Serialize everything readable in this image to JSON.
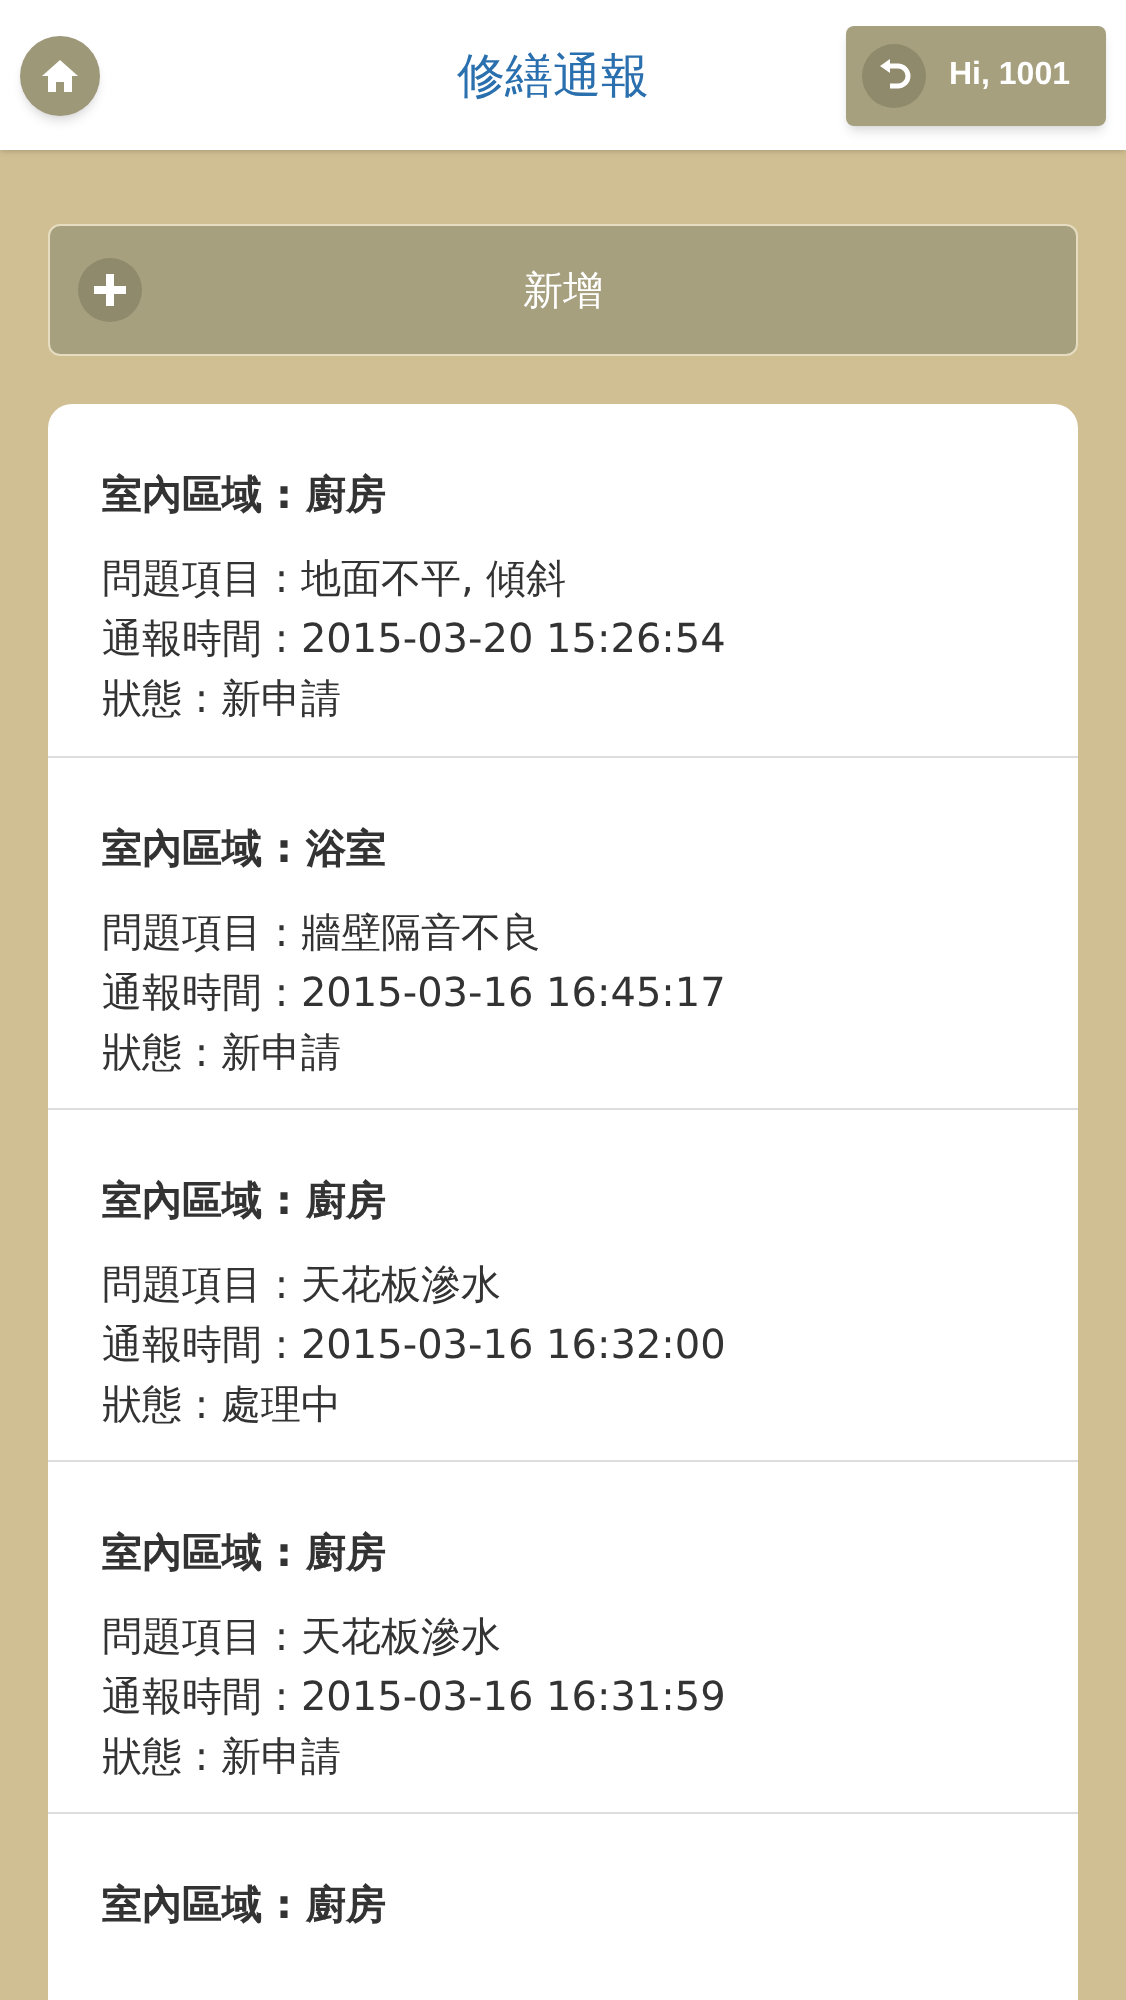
{
  "header": {
    "title": "修繕通報",
    "user_button": "Hi, 1001"
  },
  "add_button": {
    "label": "新增"
  },
  "reports": [
    {
      "area": "室內區域 : 廚房",
      "issue": "問題項目 : 地面不平, 傾斜",
      "time": "通報時間 : 2015-03-20 15:26:54",
      "status": "狀態 : 新申請"
    },
    {
      "area": "室內區域 : 浴室",
      "issue": "問題項目 : 牆壁隔音不良",
      "time": "通報時間 : 2015-03-16 16:45:17",
      "status": "狀態 : 新申請"
    },
    {
      "area": "室內區域 : 廚房",
      "issue": "問題項目 : 天花板滲水",
      "time": "通報時間 : 2015-03-16 16:32:00",
      "status": "狀態 : 處理中"
    },
    {
      "area": "室內區域 : 廚房",
      "issue": "問題項目 : 天花板滲水",
      "time": "通報時間 : 2015-03-16 16:31:59",
      "status": "狀態 : 新申請"
    },
    {
      "area": "室內區域 : 廚房"
    }
  ]
}
